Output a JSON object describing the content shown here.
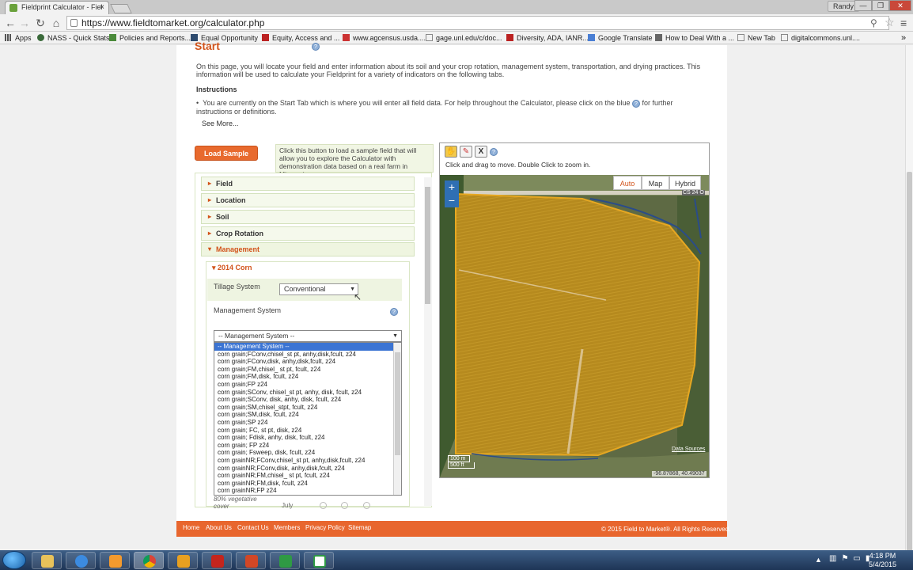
{
  "browser": {
    "tab_title": "Fieldprint Calculator - Fiel",
    "user": "Randy",
    "url": "https://www.fieldtomarket.org/calculator.php",
    "bookmarks": [
      "Apps",
      "NASS - Quick Stats",
      "Policies and Reports...",
      "Equal Opportunity",
      "Equity, Access and ...",
      "www.agcensus.usda....",
      "gage.unl.edu/c/doc...",
      "Diversity, ADA, IANR...",
      "Google Translate",
      "How to Deal With a ...",
      "New Tab",
      "digitalcommons.unl...."
    ]
  },
  "page": {
    "title": "Start",
    "intro": "On this page, you will locate your field and enter information about its soil and your crop rotation, management system, transportation, and drying practices. This information will be used to calculate your Fieldprint for a variety of indicators on the following tabs.",
    "instructions_heading": "Instructions",
    "instruction_text": "You are currently on the Start Tab which is where you will enter all field data. For help throughout the Calculator, please click on the blue",
    "instruction_text2": "for further instructions or definitions.",
    "see_more": "See More...",
    "load_sample_label": "Load Sample Field",
    "load_sample_desc": "Click this button to load a sample field that will allow you to explore the Calculator with demonstration data based on a real farm in Missouri."
  },
  "accordion": {
    "sections": [
      "Field",
      "Location",
      "Soil",
      "Crop Rotation",
      "Management"
    ],
    "subsection": "2014 Corn",
    "tillage_label": "Tillage System",
    "tillage_value": "Conventional",
    "mgmt_label": "Management System",
    "mgmt_value": "-- Management System --",
    "options": [
      "-- Management System --",
      "corn grain;FConv,chisel_st pt, anhy,disk,fcult, z24",
      "corn grain;FConv,disk, anhy,disk,fcult, z24",
      "corn grain;FM,chisel_ st pt, fcult, z24",
      "corn grain;FM,disk, fcult, z24",
      "corn grain;FP z24",
      "corn grain;SConv, chisel_st pt, anhy, disk, fcult, z24",
      "corn grain;SConv, disk, anhy, disk, fcult, z24",
      "corn grain;SM,chisel_stpt, fcult, z24",
      "corn grain;SM,disk, fcult, z24",
      "corn grain;SP z24",
      "corn grain; FC, st pt, disk, z24",
      "corn grain; Fdisk, anhy, disk, fcult, z24",
      "corn grain; FP z24",
      "corn grain; Fsweep, disk, fcult, z24",
      "corn grainNR;FConv,chisel_st pt, anhy,disk,fcult, z24",
      "corn grainNR;FConv,disk, anhy,disk,fcult, z24",
      "corn grainNR;FM,chisel_ st pt, fcult, z24",
      "corn grainNR;FM,disk, fcult, z24",
      "corn grainNR;FP z24"
    ],
    "below_label": "80% vegetative cover",
    "below_month": "July"
  },
  "map": {
    "tool_x": "X",
    "instruction": "Click and drag to move. Double Click to zoom in.",
    "types": [
      "Auto",
      "Map",
      "Hybrid"
    ],
    "road": "CS 24 O",
    "scale_m": "100 m",
    "scale_ft": "500 ft",
    "coords": "-96.87868, 40.49037",
    "data_sources": "Data Sources",
    "zoom_in": "+",
    "zoom_out": "−"
  },
  "footer": {
    "links": [
      "Home",
      "About Us",
      "Contact Us",
      "Members",
      "Privacy Policy",
      "Sitemap"
    ],
    "copyright": "© 2015 Field to Market®. All Rights Reserved."
  },
  "taskbar": {
    "time": "4:18 PM",
    "date": "5/4/2015"
  },
  "colors": {
    "accent": "#e8662e",
    "link": "#d2531a",
    "field": "#b08a1e"
  }
}
